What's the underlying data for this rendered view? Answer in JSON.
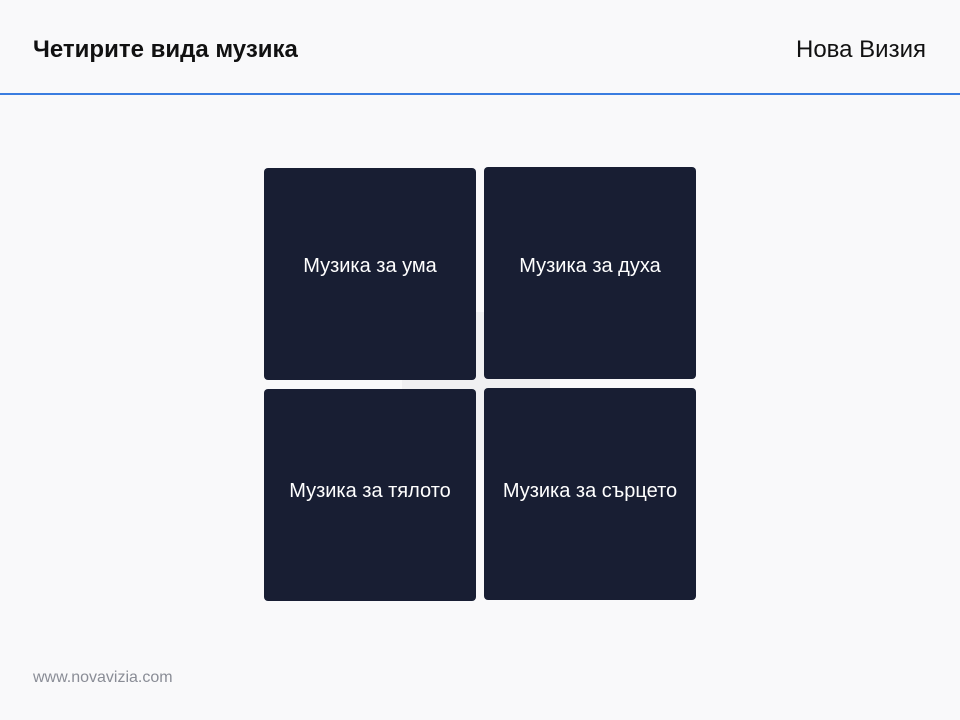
{
  "header": {
    "title": "Четирите вида музика",
    "brand": "Нова Визия"
  },
  "diagram": {
    "tiles": [
      {
        "label": "Музика за ума"
      },
      {
        "label": "Музика за духа"
      },
      {
        "label": "Музика за тялото"
      },
      {
        "label": "Музика за сърцето"
      }
    ]
  },
  "footer": {
    "url": "www.novavizia.com"
  },
  "colors": {
    "tile_background": "#181e33",
    "accent_line": "#3b7de0",
    "page_background": "#f9f9fa"
  }
}
